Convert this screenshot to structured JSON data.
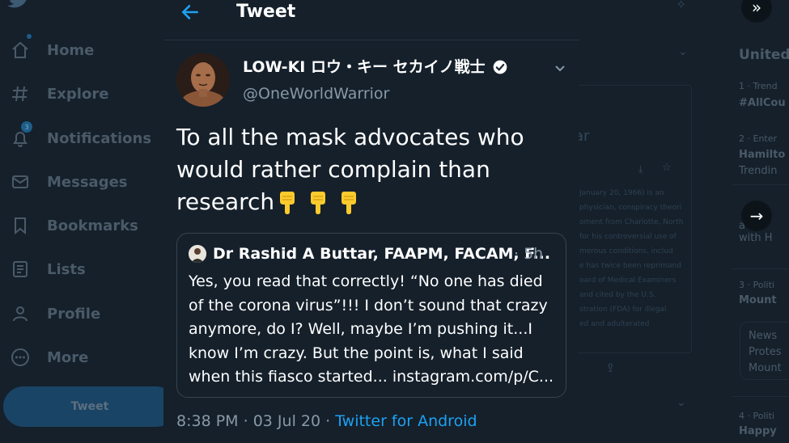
{
  "nav": {
    "items": [
      {
        "label": "Home",
        "icon": "home-icon"
      },
      {
        "label": "Explore",
        "icon": "hashtag-icon"
      },
      {
        "label": "Notifications",
        "icon": "bell-icon"
      },
      {
        "label": "Messages",
        "icon": "envelope-icon"
      },
      {
        "label": "Bookmarks",
        "icon": "bookmark-icon"
      },
      {
        "label": "Lists",
        "icon": "list-icon"
      },
      {
        "label": "Profile",
        "icon": "person-icon"
      },
      {
        "label": "More",
        "icon": "more-icon"
      }
    ],
    "tweet_button": "Tweet",
    "notification_count": "3"
  },
  "header": {
    "title": "Tweet",
    "back_icon": "arrow-left-icon"
  },
  "tweet": {
    "display_name": "LOW-KI ロウ・キー セカイノ戦士",
    "handle": "@OneWorldWarrior",
    "text": "To all the mask advocates who would rather complain than research",
    "emoji": [
      "point-down-emoji",
      "point-down-emoji",
      "point-down-emoji"
    ],
    "time": "8:38 PM",
    "separator": "·",
    "date": "03 Jul 20",
    "source": "Twitter for Android"
  },
  "quoted": {
    "name": "Dr Rashid A Buttar, FAAPM, FACAM, F...",
    "time": "· 5h",
    "text": "Yes, you read that correctly! “No one has died of the corona virus”!!! I don’t sound that crazy anymore, do I?  Well, maybe I’m pushing it...I know I’m crazy. But the point is, what I said when this fiasco started... instagram.com/p/C..."
  },
  "right": {
    "heading": "United",
    "trends": [
      {
        "meta": "1 · Trend",
        "title": "#AllCou"
      },
      {
        "meta": "2 · Enter",
        "title": "Hamilto",
        "sub": "Trendin"
      },
      {
        "meta": "3 · Politi",
        "title": "Mount"
      },
      {
        "meta": "4 · Politi",
        "title": "Happy"
      }
    ],
    "news": [
      "News",
      "Protes",
      "Mount"
    ],
    "ghost_title": "ar",
    "ghost_lines": [
      "January 20, 1966) is an",
      "physician, conspiracy theori",
      "oment from Charlotte, North",
      "for his controversial use of",
      "merous conditions, includ",
      "e has twice been reprimand",
      "oard of Medical Examiners",
      "and cited by the U.S.",
      "stration (FDA) for illegal",
      "ed and adulterated"
    ],
    "wih": "with H",
    "sa": "a"
  },
  "colors": {
    "accent": "#1da1f2",
    "background": "#15202b",
    "secondary_text": "#8899a6",
    "border": "#38444d"
  }
}
